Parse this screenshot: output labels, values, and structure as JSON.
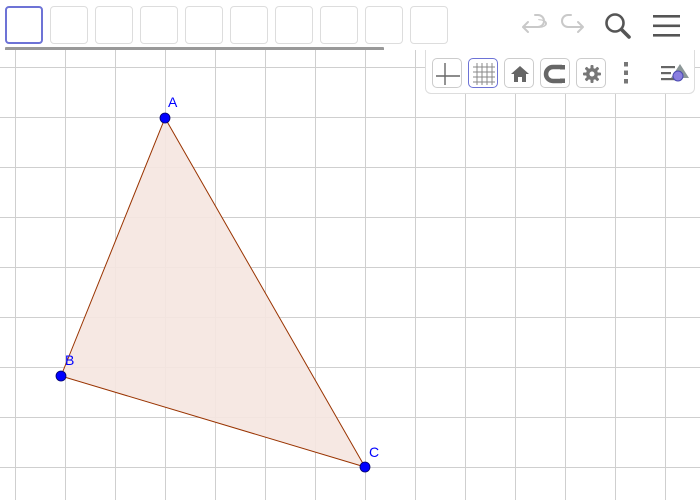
{
  "app": {
    "toolbar": {
      "slot_count": 10,
      "selected_index": 0,
      "icons": [
        "undo-icon",
        "redo-icon",
        "search-icon",
        "menu-icon"
      ]
    },
    "stylebar": {
      "buttons": [
        "axes-toggle",
        "grid-toggle",
        "standard-view-home",
        "point-capturing-magnet",
        "graphics-settings-gear",
        "more-options",
        "toggle-style-bar"
      ]
    }
  },
  "construction": {
    "points": [
      {
        "name": "A",
        "label": "A"
      },
      {
        "name": "B",
        "label": "B"
      },
      {
        "name": "C",
        "label": "C"
      }
    ],
    "polygon": {
      "vertices": [
        "A",
        "B",
        "C"
      ]
    },
    "colors": {
      "point": "#0000ff",
      "polygon_stroke": "#993300",
      "polygon_fill": "#f5e6e0",
      "grid": "#cfcfcf",
      "accent": "#6d73d6"
    }
  }
}
